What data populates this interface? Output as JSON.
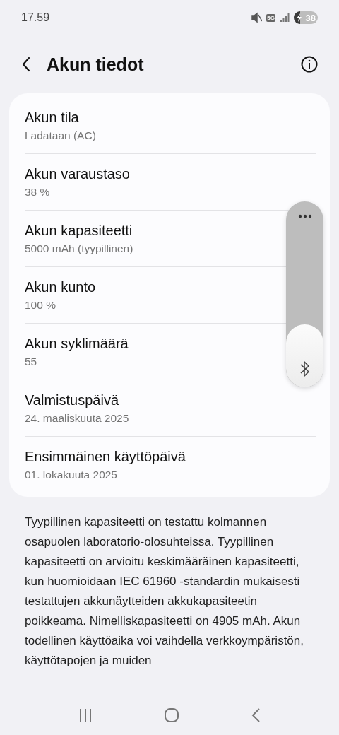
{
  "status_bar": {
    "time": "17.59",
    "network": "5G",
    "battery": "38",
    "charging": true,
    "muted": true
  },
  "header": {
    "title": "Akun tiedot"
  },
  "items": [
    {
      "title": "Akun tila",
      "value": "Ladataan (AC)"
    },
    {
      "title": "Akun varaustaso",
      "value": "38 %"
    },
    {
      "title": "Akun kapasiteetti",
      "value": "5000 mAh (tyypillinen)"
    },
    {
      "title": "Akun kunto",
      "value": "100 %"
    },
    {
      "title": "Akun syklimäärä",
      "value": "55"
    },
    {
      "title": "Valmistuspäivä",
      "value": "24. maaliskuuta 2025"
    },
    {
      "title": "Ensimmäinen käyttöpäivä",
      "value": "01. lokakuuta 2025"
    }
  ],
  "note": "Tyypillinen kapasiteetti on testattu kolmannen osapuolen laboratorio-olosuhteissa. Tyypillinen kapasiteetti on arvioitu keskimääräinen kapasiteetti, kun huomioidaan IEC 61960 -standardin mukaisesti testattujen akkunäytteiden akkukapasiteetin poikkeama. Nimelliskapasiteetti on 4905 mAh. Akun todellinen käyttöaika voi vaihdella verkkoympäristön, käyttötapojen ja muiden",
  "volume_panel": {
    "level": 0.34
  }
}
